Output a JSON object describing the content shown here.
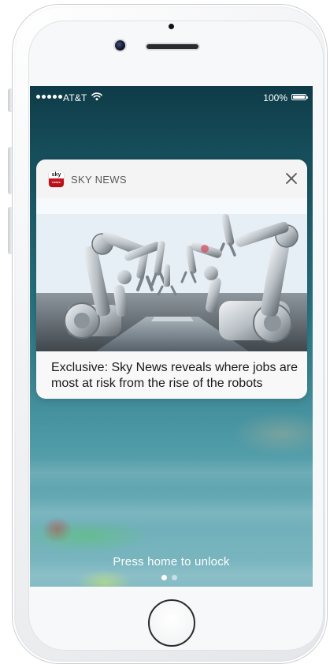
{
  "status_bar": {
    "carrier": "AT&T",
    "battery": "100%",
    "battery_level": 1.0
  },
  "notification": {
    "app_name": "SKY NEWS",
    "app_icon": {
      "name": "sky-news-icon",
      "top_text": "sky",
      "bottom_text": "news"
    },
    "close_icon": "close-icon",
    "image": "robot-arms-image",
    "text": "Exclusive: Sky News reveals where jobs are most at risk from the rise of the robots"
  },
  "lockscreen": {
    "unlock_hint": "Press home to unlock",
    "pages": 2,
    "current_page": 1
  },
  "colors": {
    "sky_red": "#c9141c",
    "screen_top": "#0f3b48",
    "screen_bottom": "#7fb8c1"
  }
}
